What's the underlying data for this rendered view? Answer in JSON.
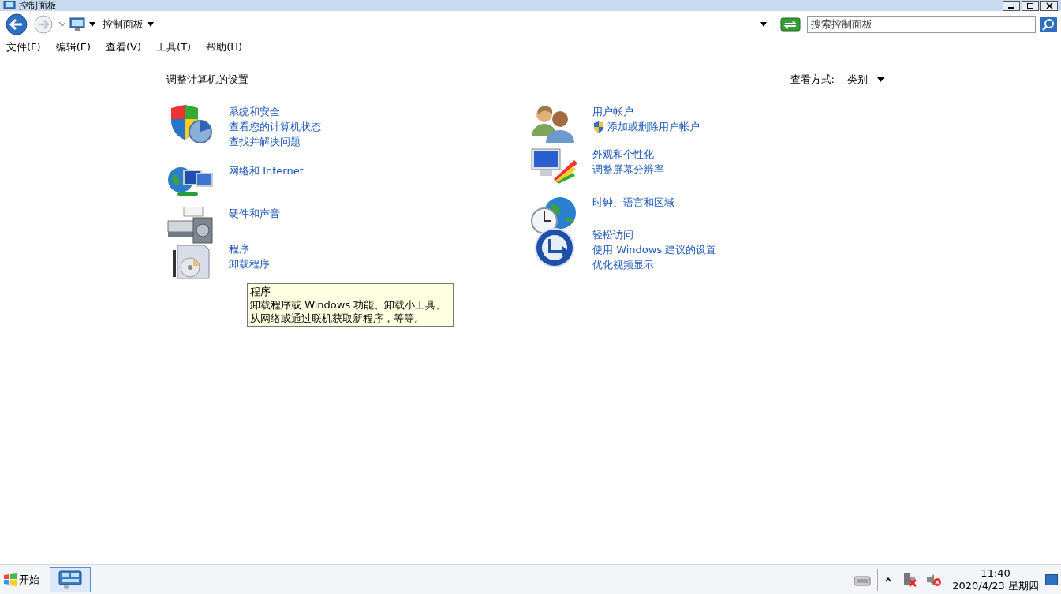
{
  "window": {
    "title": "控制面板"
  },
  "address_bar": {
    "path": "控制面板",
    "search_placeholder": "搜索控制面板"
  },
  "menu": [
    "文件(F)",
    "编辑(E)",
    "查看(V)",
    "工具(T)",
    "帮助(H)"
  ],
  "heading": "调整计算机的设置",
  "view_by": {
    "label": "查看方式:",
    "value": "类别"
  },
  "columns": [
    [
      {
        "kind": "security",
        "title": "系统和安全",
        "links": [
          {
            "text": "查看您的计算机状态",
            "shield": false
          },
          {
            "text": "查找并解决问题",
            "shield": false
          }
        ]
      },
      {
        "kind": "network",
        "title": "网络和 Internet"
      },
      {
        "kind": "hardware",
        "title": "硬件和声音"
      },
      {
        "kind": "programs",
        "title": "程序",
        "links": [
          {
            "text": "卸载程序",
            "shield": false
          }
        ]
      }
    ],
    [
      {
        "kind": "users",
        "title": "用户帐户",
        "links": [
          {
            "text": "添加或删除用户帐户",
            "shield": true
          }
        ]
      },
      {
        "kind": "appearance",
        "title": "外观和个性化",
        "links": [
          {
            "text": "调整屏幕分辨率",
            "shield": false
          }
        ]
      },
      {
        "kind": "region",
        "title": "时钟、语言和区域"
      },
      {
        "kind": "access",
        "title": "轻松访问",
        "links": [
          {
            "text": "使用 Windows 建议的设置",
            "shield": false
          },
          {
            "text": "优化视频显示",
            "shield": false
          }
        ]
      }
    ]
  ],
  "tooltip": {
    "title": "程序",
    "text": "卸载程序或 Windows 功能、卸载小工具、从网络或通过联机获取新程序，等等。"
  },
  "taskbar": {
    "start": "开始",
    "time": "11:40",
    "date": "2020/4/23 星期四"
  }
}
